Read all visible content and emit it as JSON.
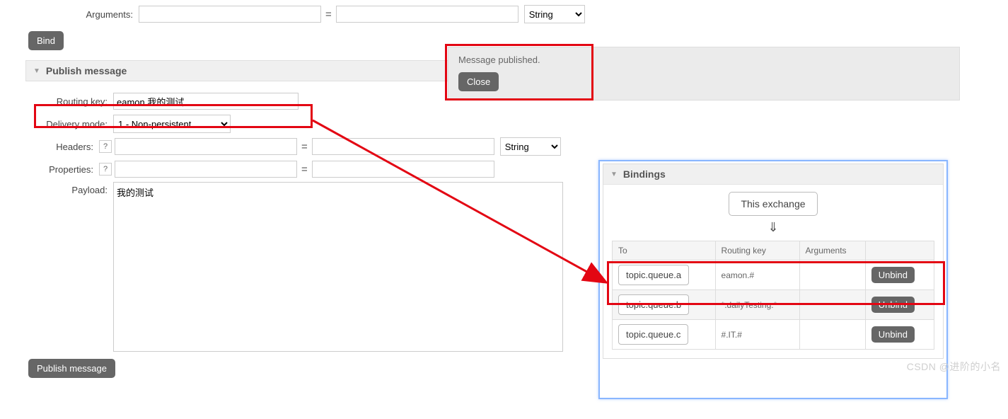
{
  "arguments_row": {
    "label": "Arguments:",
    "key_value": "",
    "val_value": "",
    "type_options": [
      "String"
    ],
    "type_selected": "String"
  },
  "bind_button": "Bind",
  "notification": {
    "text": "Message published.",
    "close_label": "Close"
  },
  "publish_section": {
    "title": "Publish message",
    "routing_key": {
      "label": "Routing key:",
      "value": "eamon.我的测试"
    },
    "delivery_mode": {
      "label": "Delivery mode:",
      "options": [
        "1 - Non-persistent"
      ],
      "selected": "1 - Non-persistent"
    },
    "headers": {
      "label": "Headers:",
      "help": "?",
      "key_value": "",
      "val_value": "",
      "type_options": [
        "String"
      ],
      "type_selected": "String"
    },
    "properties": {
      "label": "Properties:",
      "help": "?",
      "key_value": "",
      "val_value": ""
    },
    "payload": {
      "label": "Payload:",
      "value": "我的测试"
    },
    "publish_button": "Publish message"
  },
  "bindings_panel": {
    "title": "Bindings",
    "this_exchange_label": "This exchange",
    "down_arrow": "⇓",
    "headers": [
      "To",
      "Routing key",
      "Arguments",
      ""
    ],
    "rows": [
      {
        "to": "topic.queue.a",
        "routing_key": "eamon.#",
        "arguments": "",
        "action": "Unbind"
      },
      {
        "to": "topic.queue.b",
        "routing_key": "*.dailyTesting.*",
        "arguments": "",
        "action": "Unbind"
      },
      {
        "to": "topic.queue.c",
        "routing_key": "#.IT.#",
        "arguments": "",
        "action": "Unbind"
      }
    ]
  },
  "watermark": "CSDN @进阶的小名"
}
